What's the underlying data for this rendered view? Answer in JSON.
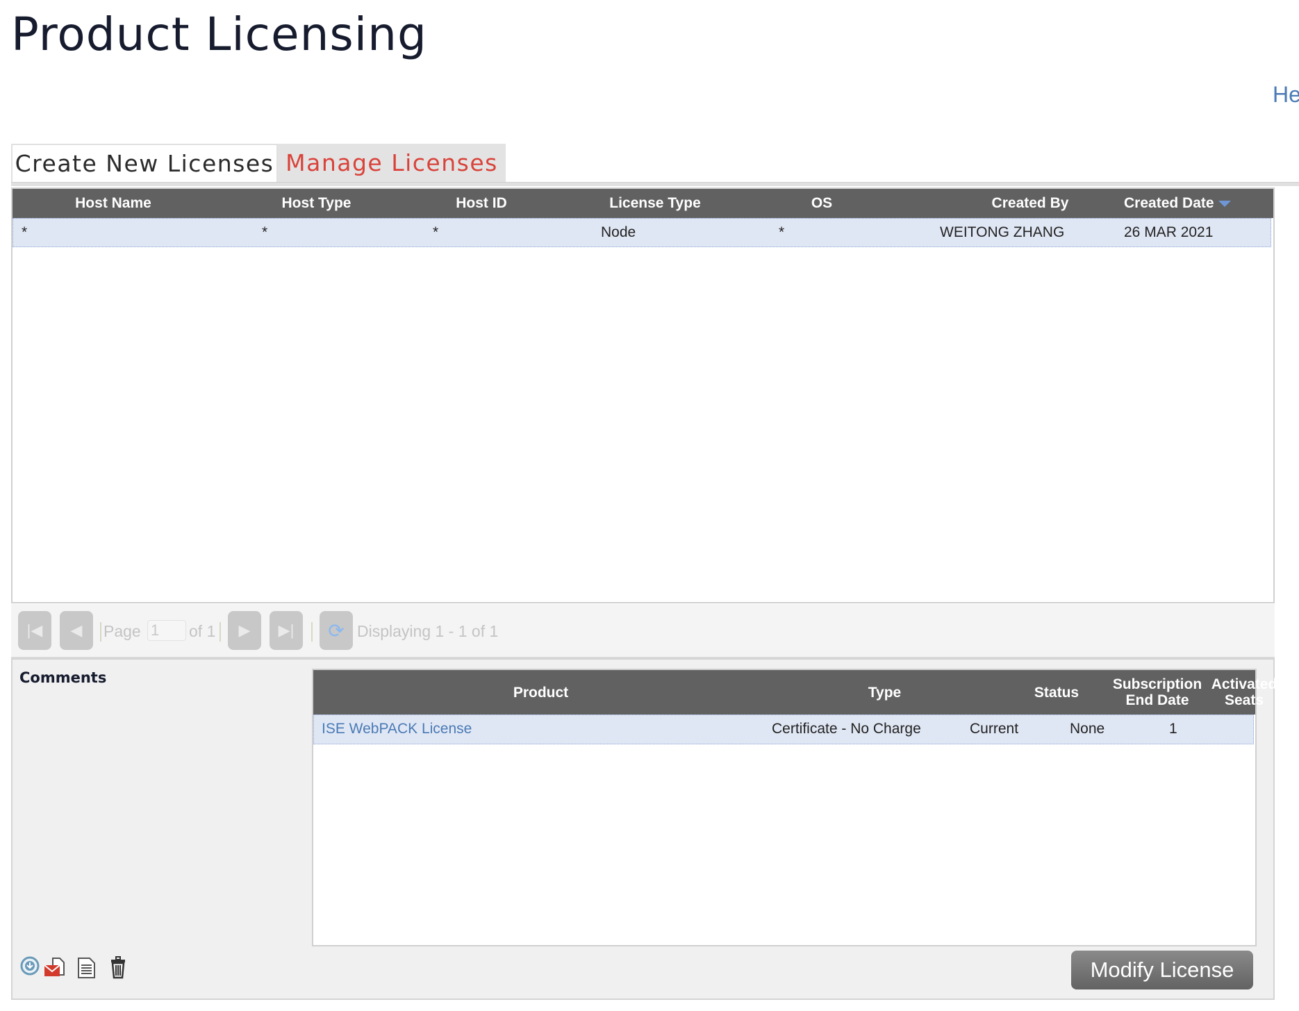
{
  "page": {
    "title": "Product Licensing",
    "help_link": "He"
  },
  "tabs": [
    {
      "label": "Create New Licenses",
      "active": false
    },
    {
      "label": "Manage Licenses",
      "active": true
    }
  ],
  "hosts_grid": {
    "columns": [
      "Host Name",
      "Host Type",
      "Host ID",
      "License Type",
      "OS",
      "Created By",
      "Created Date"
    ],
    "sort": {
      "column": "Created Date",
      "direction": "descending"
    },
    "rows": [
      {
        "host_name": "*",
        "host_type": "*",
        "host_id": "*",
        "license_type": "Node",
        "os": "*",
        "created_by": "WEITONG ZHANG",
        "created_date": "26 MAR 2021"
      }
    ]
  },
  "pager": {
    "page_label": "Page",
    "page_value": "1",
    "of_label": "of 1",
    "display_text": "Displaying 1 - 1 of 1",
    "buttons": [
      "first-page",
      "previous-page",
      "next-page",
      "last-page",
      "refresh"
    ]
  },
  "details": {
    "comments_label": "Comments",
    "product_grid": {
      "columns": [
        "Product",
        "Type",
        "Status",
        "Subscription End Date",
        "Activated Seats"
      ],
      "column_lines": [
        [
          "Product"
        ],
        [
          "Type"
        ],
        [
          "Status"
        ],
        [
          "Subscription",
          "End Date"
        ],
        [
          "Activated",
          "Seats"
        ]
      ],
      "rows": [
        {
          "product": "ISE WebPACK License",
          "type": "Certificate - No Charge",
          "status": "Current",
          "subscription_end_date": "None",
          "activated_seats": "1"
        }
      ]
    },
    "action_icons": [
      "download-icon",
      "email-icon",
      "document-icon",
      "trash-icon"
    ],
    "modify_button": "Modify License"
  },
  "colors": {
    "active_tab_text": "#d9433a",
    "header_bg": "#616161",
    "selected_row_bg": "#e0e7f4",
    "link": "#4a7ab5"
  }
}
